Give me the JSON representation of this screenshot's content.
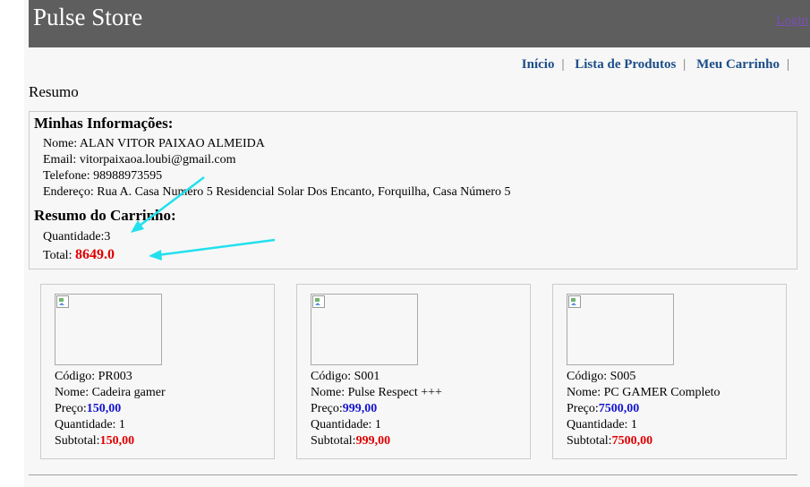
{
  "header": {
    "brand": "Pulse Store",
    "login": "Login"
  },
  "nav": {
    "items": [
      "Início",
      "Lista de Produtos",
      "Meu Carrinho"
    ]
  },
  "page": {
    "title": "Resumo"
  },
  "info": {
    "heading": "Minhas Informações:",
    "name_label": "Nome: ",
    "name": "ALAN VITOR PAIXAO ALMEIDA",
    "email_label": "Email: ",
    "email": "vitorpaixaoa.loubi@gmail.com",
    "phone_label": "Telefone: ",
    "phone": "98988973595",
    "address_label": "Endereço: ",
    "address": "Rua A. Casa Numero 5 Residencial Solar Dos Encanto, Forquilha, Casa Número 5"
  },
  "cart": {
    "heading": "Resumo do Carrinho:",
    "quantity_label": "Quantidade:",
    "quantity": "3",
    "total_label": "Total: ",
    "total": "8649.0"
  },
  "products": [
    {
      "code_label": "Código: ",
      "code": "PR003",
      "name_label": "Nome: ",
      "name": "Cadeira gamer",
      "price_label": "Preço:",
      "price": "150,00",
      "qty_label": "Quantidade: ",
      "qty": "1",
      "subtotal_label": "Subtotal:",
      "subtotal": "150,00"
    },
    {
      "code_label": "Código: ",
      "code": "S001",
      "name_label": "Nome: ",
      "name": "Pulse Respect +++",
      "price_label": "Preço:",
      "price": "999,00",
      "qty_label": "Quantidade: ",
      "qty": "1",
      "subtotal_label": "Subtotal:",
      "subtotal": "999,00"
    },
    {
      "code_label": "Código: ",
      "code": "S005",
      "name_label": "Nome: ",
      "name": "PC GAMER Completo",
      "price_label": "Preço:",
      "price": "7500,00",
      "qty_label": "Quantidade: ",
      "qty": "1",
      "subtotal_label": "Subtotal:",
      "subtotal": "7500,00"
    }
  ],
  "colors": {
    "header_bg": "#5e5e5e",
    "nav_link": "#1d4e89",
    "price": "#1515d0",
    "subtotal": "#e00000",
    "annotation_arrow": "#22e0ee"
  }
}
